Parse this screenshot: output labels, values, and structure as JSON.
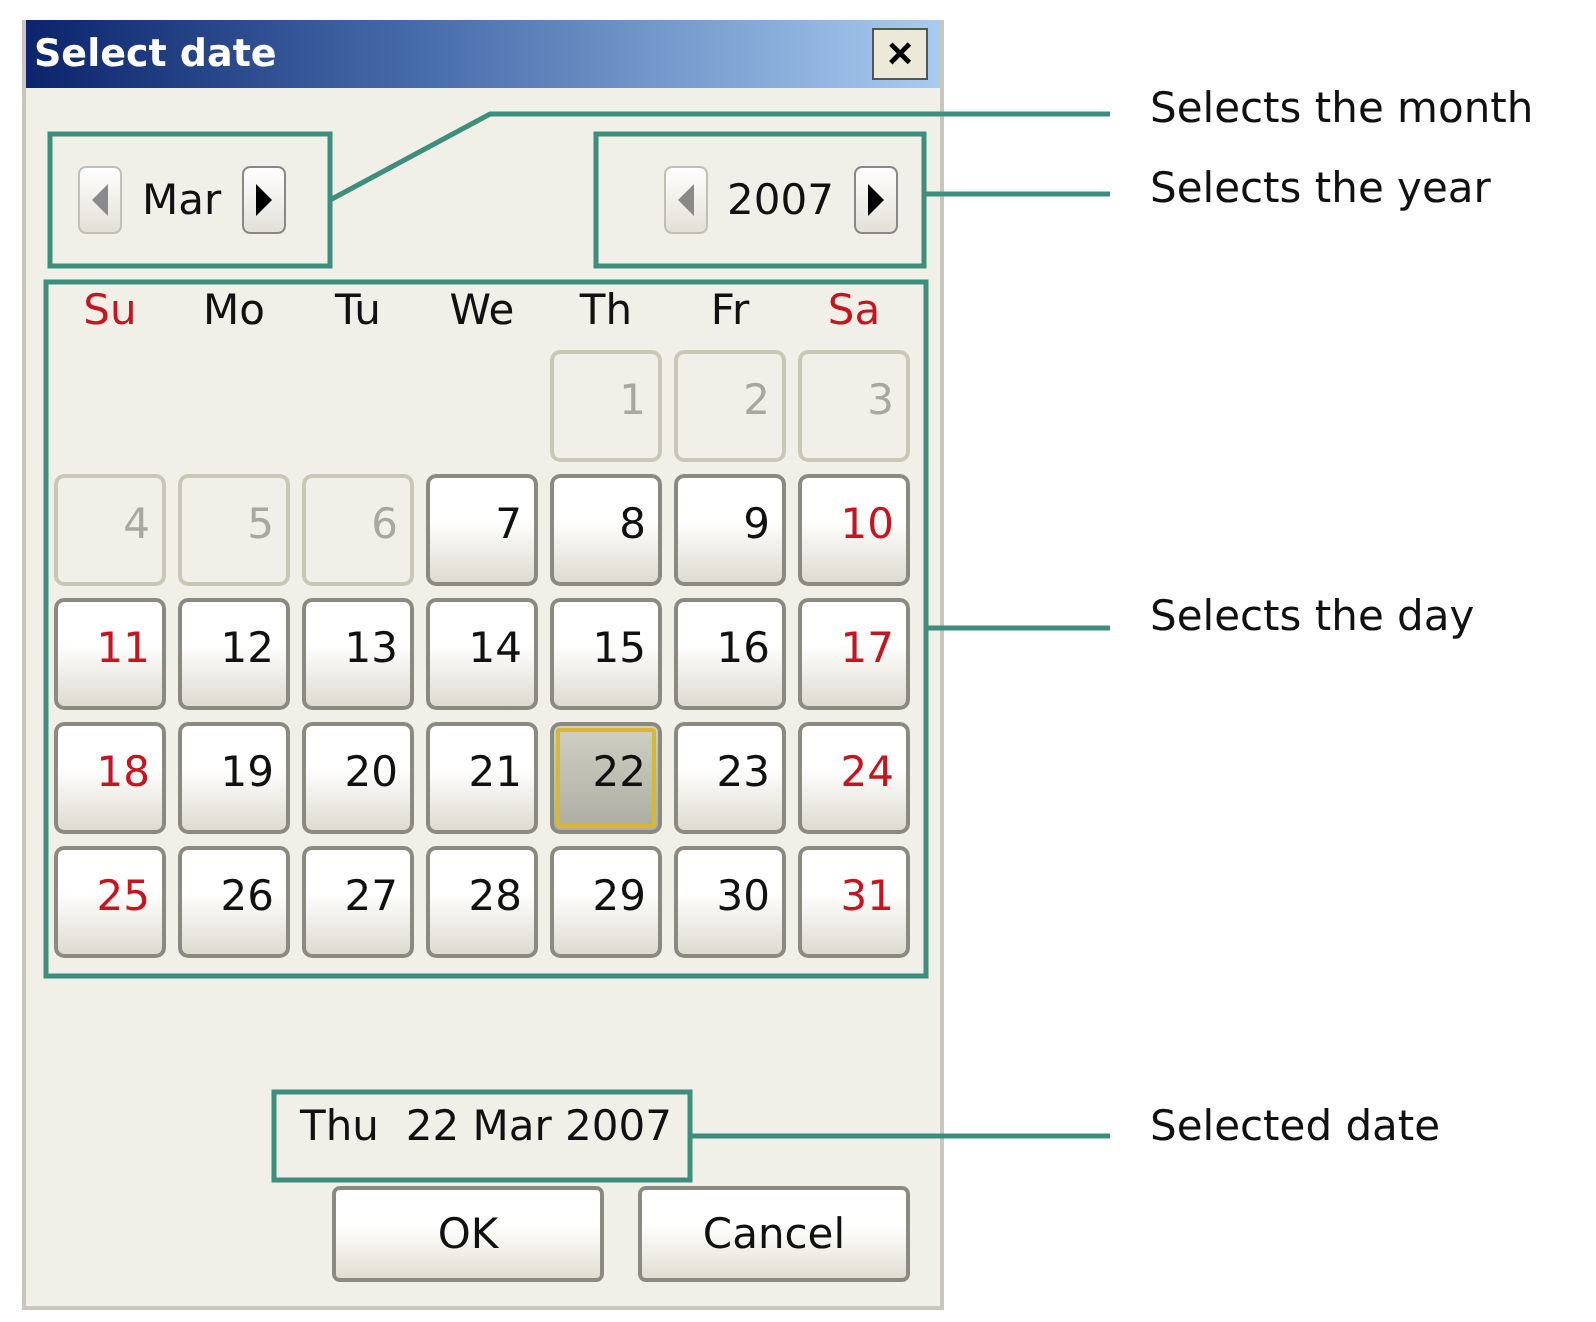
{
  "window": {
    "title": "Select date",
    "close": "×"
  },
  "month_nav": {
    "prev_disabled": true,
    "value": "Mar",
    "next_disabled": false
  },
  "year_nav": {
    "prev_disabled": true,
    "value": "2007",
    "next_disabled": false
  },
  "weekdays": [
    {
      "label": "Su",
      "weekend": true
    },
    {
      "label": "Mo",
      "weekend": false
    },
    {
      "label": "Tu",
      "weekend": false
    },
    {
      "label": "We",
      "weekend": false
    },
    {
      "label": "Th",
      "weekend": false
    },
    {
      "label": "Fr",
      "weekend": false
    },
    {
      "label": "Sa",
      "weekend": true
    }
  ],
  "weeks": [
    [
      {
        "kind": "blank"
      },
      {
        "kind": "blank"
      },
      {
        "kind": "blank"
      },
      {
        "kind": "blank"
      },
      {
        "day": "1",
        "disabled": true,
        "selected": false
      },
      {
        "day": "2",
        "disabled": true,
        "selected": false
      },
      {
        "day": "3",
        "disabled": true,
        "selected": false
      }
    ],
    [
      {
        "day": "4",
        "disabled": true,
        "selected": false
      },
      {
        "day": "5",
        "disabled": true,
        "selected": false
      },
      {
        "day": "6",
        "disabled": true,
        "selected": false
      },
      {
        "day": "7",
        "weekend": false,
        "disabled": false,
        "selected": false
      },
      {
        "day": "8",
        "weekend": false,
        "disabled": false,
        "selected": false
      },
      {
        "day": "9",
        "weekend": false,
        "disabled": false,
        "selected": false
      },
      {
        "day": "10",
        "weekend": true,
        "disabled": false,
        "selected": false
      }
    ],
    [
      {
        "day": "11",
        "weekend": true,
        "disabled": false,
        "selected": false
      },
      {
        "day": "12",
        "weekend": false,
        "disabled": false,
        "selected": false
      },
      {
        "day": "13",
        "weekend": false,
        "disabled": false,
        "selected": false
      },
      {
        "day": "14",
        "weekend": false,
        "disabled": false,
        "selected": false
      },
      {
        "day": "15",
        "weekend": false,
        "disabled": false,
        "selected": false
      },
      {
        "day": "16",
        "weekend": false,
        "disabled": false,
        "selected": false
      },
      {
        "day": "17",
        "weekend": true,
        "disabled": false,
        "selected": false
      }
    ],
    [
      {
        "day": "18",
        "weekend": true,
        "disabled": false,
        "selected": false
      },
      {
        "day": "19",
        "weekend": false,
        "disabled": false,
        "selected": false
      },
      {
        "day": "20",
        "weekend": false,
        "disabled": false,
        "selected": false
      },
      {
        "day": "21",
        "weekend": false,
        "disabled": false,
        "selected": false
      },
      {
        "day": "22",
        "weekend": false,
        "disabled": false,
        "selected": true
      },
      {
        "day": "23",
        "weekend": false,
        "disabled": false,
        "selected": false
      },
      {
        "day": "24",
        "weekend": true,
        "disabled": false,
        "selected": false
      }
    ],
    [
      {
        "day": "25",
        "weekend": true,
        "disabled": false,
        "selected": false
      },
      {
        "day": "26",
        "weekend": false,
        "disabled": false,
        "selected": false
      },
      {
        "day": "27",
        "weekend": false,
        "disabled": false,
        "selected": false
      },
      {
        "day": "28",
        "weekend": false,
        "disabled": false,
        "selected": false
      },
      {
        "day": "29",
        "weekend": false,
        "disabled": false,
        "selected": false
      },
      {
        "day": "30",
        "weekend": false,
        "disabled": false,
        "selected": false
      },
      {
        "day": "31",
        "weekend": true,
        "disabled": false,
        "selected": false
      }
    ]
  ],
  "selected_date": "Thu  22 Mar 2007",
  "buttons": [
    "OK",
    "Cancel"
  ],
  "annotations": [
    "Selects the month",
    "Selects the year",
    "Selects the day",
    "Selected date"
  ]
}
